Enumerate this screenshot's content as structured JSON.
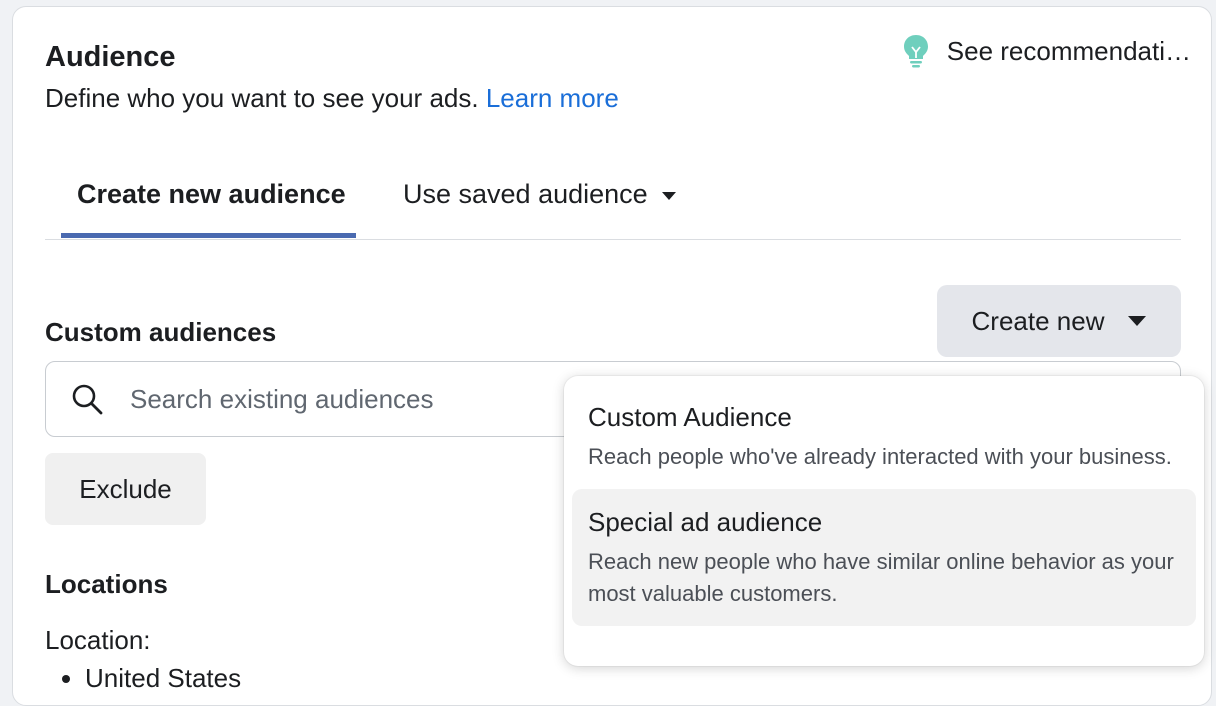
{
  "header": {
    "title": "Audience",
    "subtitle": "Define who you want to see your ads.",
    "learn_more": "Learn more",
    "recommendations": "See recommendati…"
  },
  "tabs": [
    {
      "label": "Create new audience",
      "active": true
    },
    {
      "label": "Use saved audience",
      "active": false
    }
  ],
  "create_new_button": "Create new",
  "custom_audiences": {
    "label": "Custom audiences",
    "search_placeholder": "Search existing audiences",
    "exclude_label": "Exclude"
  },
  "locations": {
    "label": "Locations",
    "location_label": "Location:",
    "items": [
      "United States"
    ]
  },
  "dropdown": {
    "items": [
      {
        "title": "Custom Audience",
        "description": "Reach people who've already interacted with your business."
      },
      {
        "title": "Special ad audience",
        "description": "Reach new people who have similar online behavior as your most valuable customers."
      }
    ]
  },
  "colors": {
    "link": "#1a6ed8",
    "tab_indicator": "#4a6ab0",
    "bulb": "#6fcfbd"
  },
  "icons": [
    "lightbulb-icon",
    "chevron-down-icon",
    "search-icon"
  ]
}
